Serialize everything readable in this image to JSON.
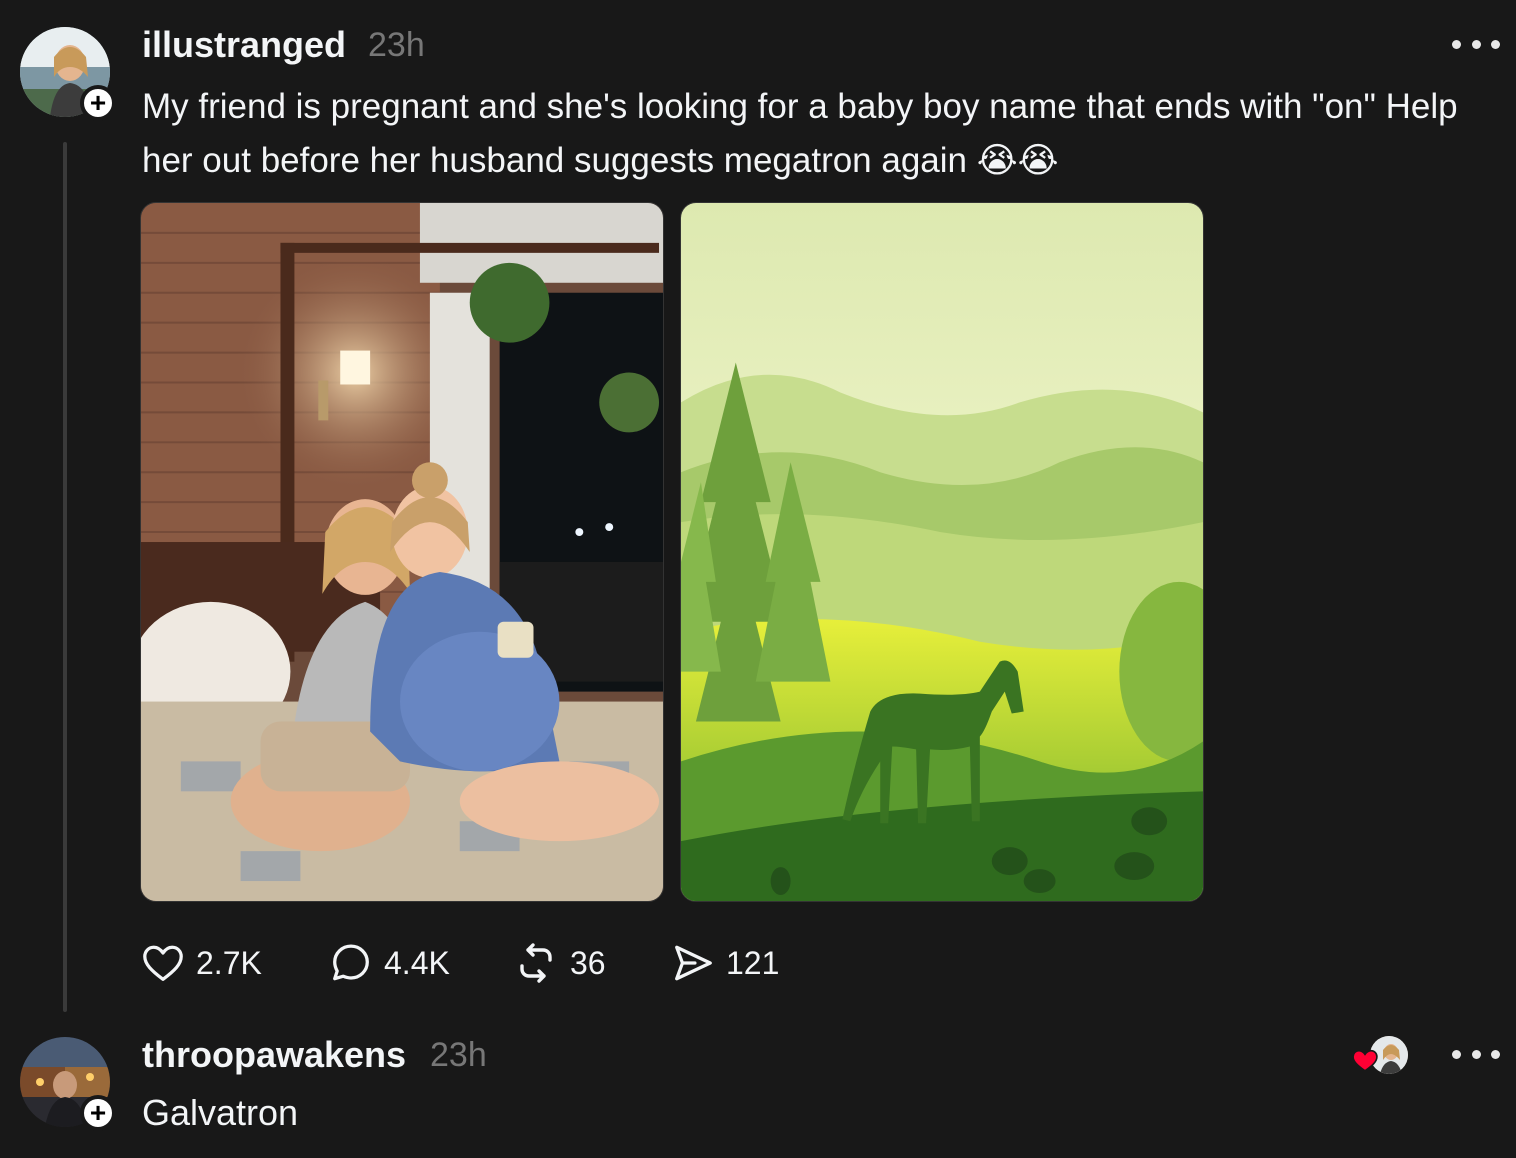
{
  "post": {
    "author": "illustranged",
    "time": "23h",
    "text": "My friend is pregnant and she's looking for a baby boy name that ends with \"on\" Help her out before her husband suggests megatron again 😭😭",
    "follow_symbol": "+",
    "media": [
      {
        "icon": "photo-two-women-on-bed"
      },
      {
        "icon": "illustration-horse-green-landscape"
      }
    ],
    "actions": {
      "likes": "2.7K",
      "replies": "4.4K",
      "reposts": "36",
      "shares": "121"
    }
  },
  "reply": {
    "author": "throopawakens",
    "time": "23h",
    "text": "Galvatron",
    "follow_symbol": "+",
    "liked_by_author_icon": "heart-icon",
    "heart_color": "#ff0034"
  },
  "colors": {
    "background": "#181818",
    "text": "#f3f5f7",
    "muted": "#777777",
    "thread_line": "#3a3a3a"
  }
}
